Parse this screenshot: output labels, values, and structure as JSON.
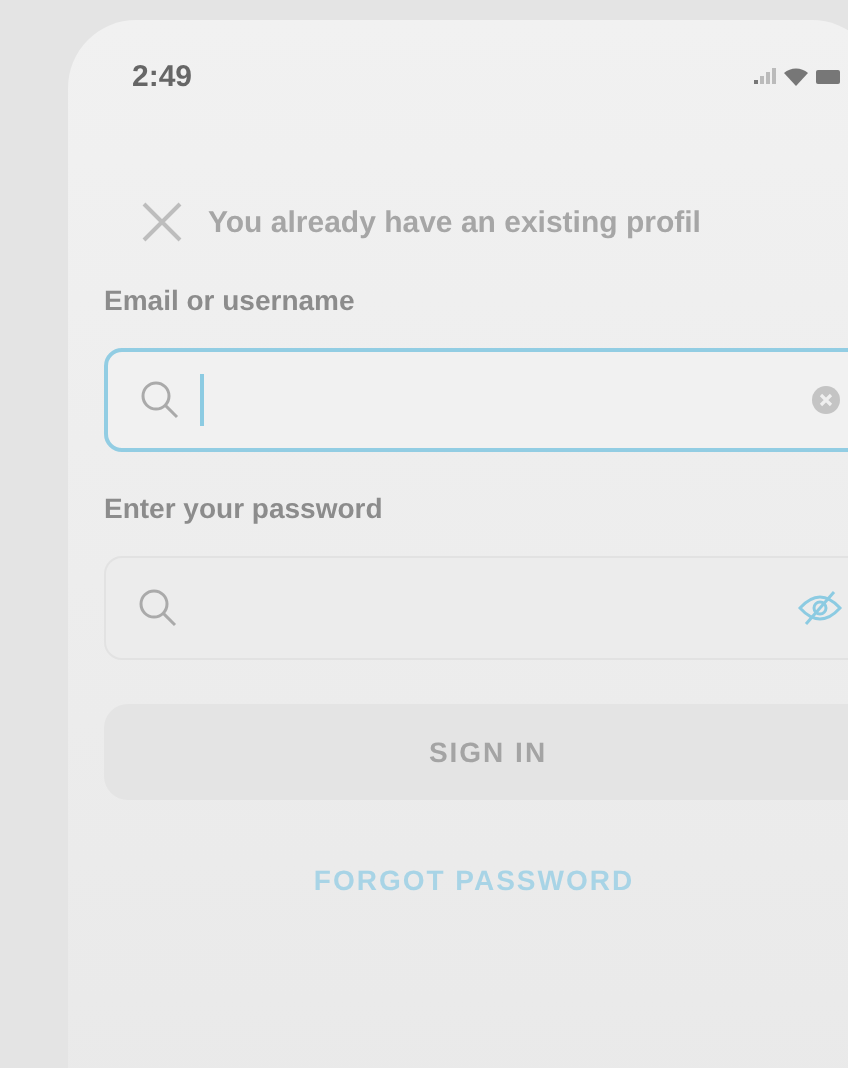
{
  "status_bar": {
    "time": "2:49"
  },
  "header": {
    "title": "You already have an existing profil"
  },
  "fields": [
    {
      "label": "Email or username",
      "focused": true,
      "kind": "clearable"
    },
    {
      "label": "Enter your password",
      "focused": false,
      "kind": "password"
    }
  ],
  "sign_in_button": {
    "label": "SIGN IN",
    "disabled": true
  },
  "forgot_password_link": {
    "label": "FORGOT PASSWORD"
  }
}
